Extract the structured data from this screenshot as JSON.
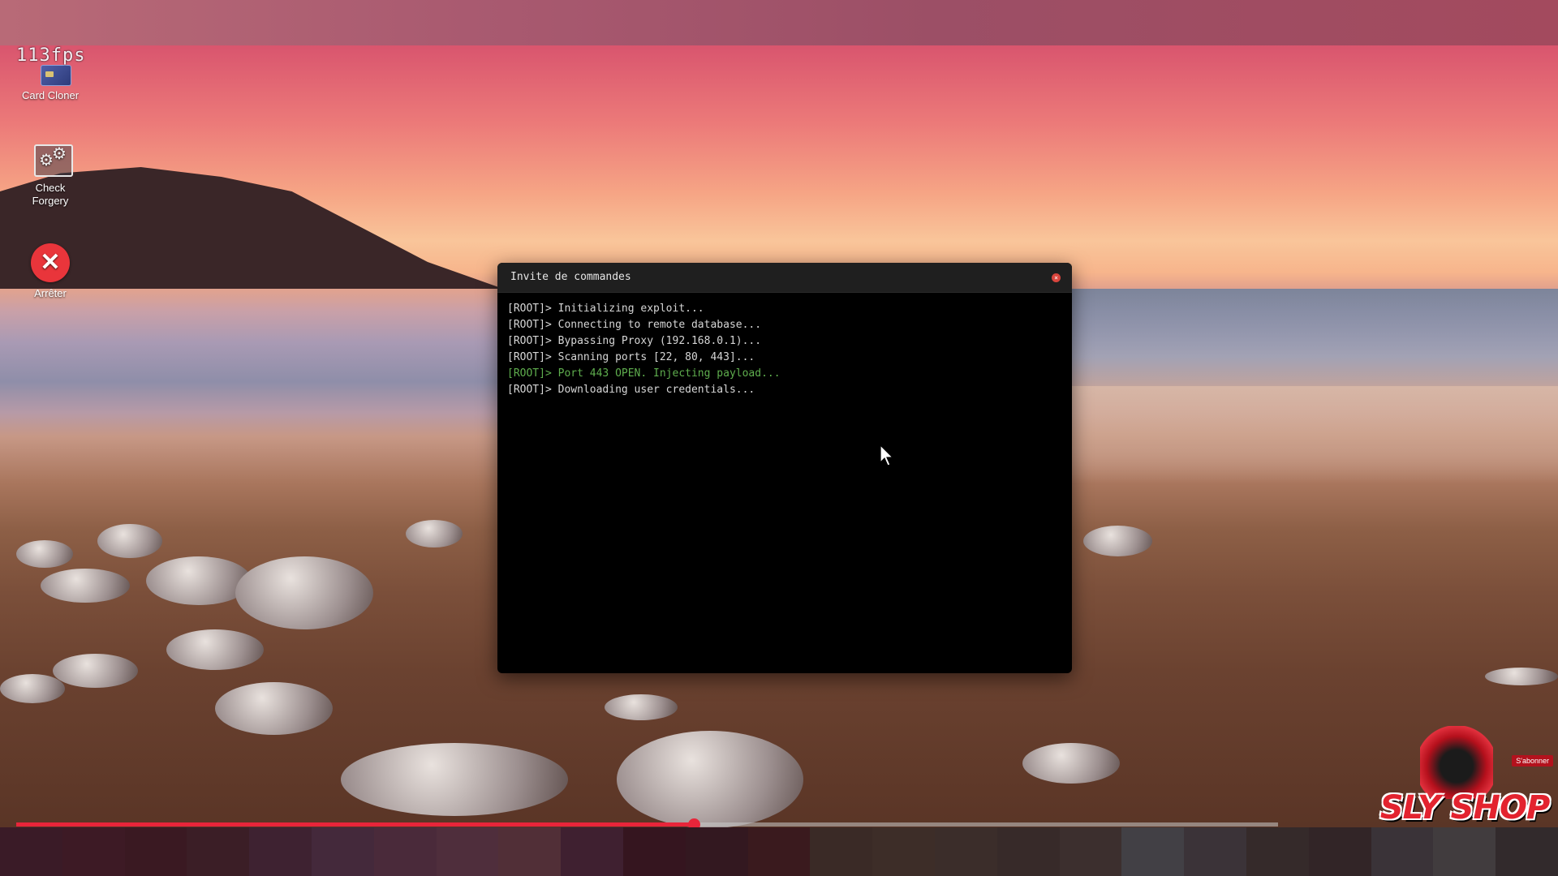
{
  "overlay": {
    "fps": "113fps"
  },
  "desktop": {
    "icons": [
      {
        "label": "Card Cloner",
        "icon": "credit-card-icon"
      },
      {
        "label": "Check\nForgery",
        "icon": "gears-icon"
      },
      {
        "label": "Arrêter",
        "icon": "close-icon"
      }
    ]
  },
  "terminal": {
    "title": "Invite de commandes",
    "lines": [
      {
        "prompt": "[ROOT]>",
        "text": "Initializing exploit...",
        "color": "#d6d6d6"
      },
      {
        "prompt": "[ROOT]>",
        "text": "Connecting to remote database...",
        "color": "#d6d6d6"
      },
      {
        "prompt": "[ROOT]>",
        "text": "Bypassing Proxy (192.168.0.1)...",
        "color": "#d6d6d6"
      },
      {
        "prompt": "[ROOT]>",
        "text": "Scanning ports [22, 80, 443]...",
        "color": "#d6d6d6"
      },
      {
        "prompt": "[ROOT]>",
        "text": "Port 443 OPEN. Injecting payload...",
        "color": "#5fae4e"
      },
      {
        "prompt": "[ROOT]>",
        "text": "Downloading user credentials...",
        "color": "#d6d6d6"
      }
    ]
  },
  "video": {
    "progress": 0.537,
    "accent": "#e8253a"
  },
  "logo": {
    "text": "SLY SHOP",
    "badge": "S'abonner"
  },
  "colors": {
    "bottom_strip": [
      "#3a1b27",
      "#3d1a25",
      "#3a1922",
      "#3b1e26",
      "#3e2231",
      "#44293b",
      "#4a2a3a",
      "#4f2e3c",
      "#512f37",
      "#3f2030",
      "#35151f",
      "#331820",
      "#3a1a1e",
      "#3a2a26",
      "#3d2d28",
      "#3b2d2a",
      "#372a29",
      "#3c2f2e",
      "#424045",
      "#3b3338",
      "#352a2a",
      "#322527",
      "#3a3338",
      "#413c3e",
      "#322a2c"
    ]
  }
}
